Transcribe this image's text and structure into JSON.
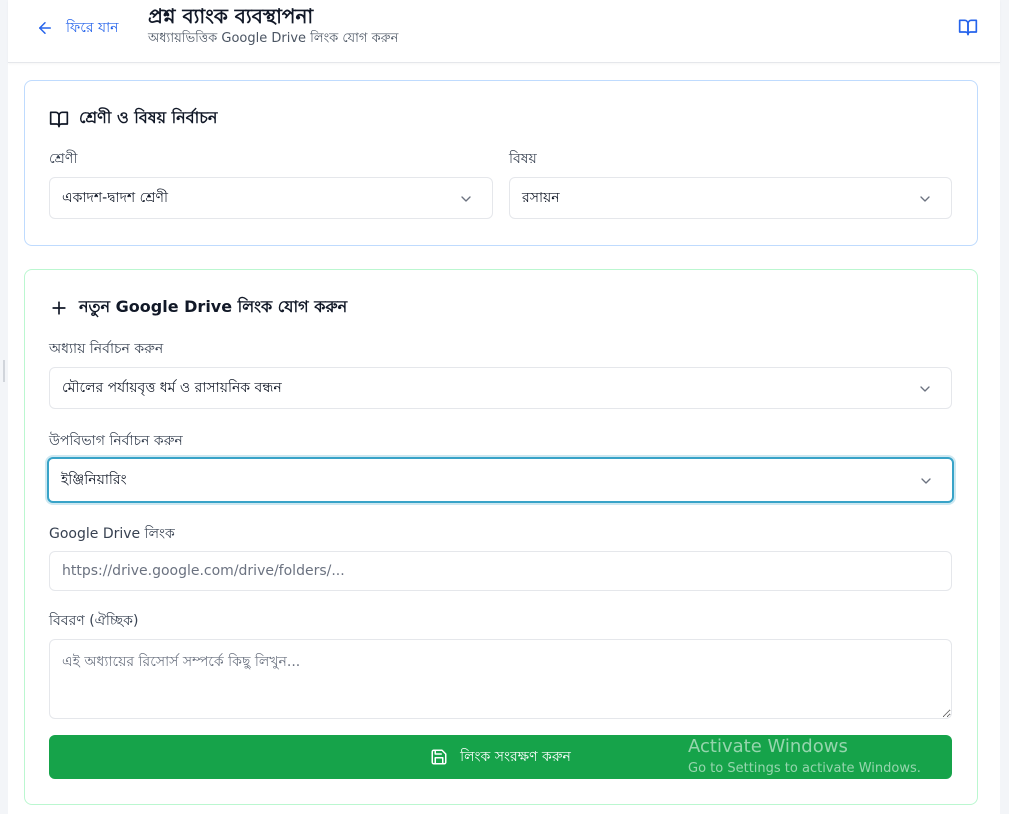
{
  "header": {
    "back_label": "ফিরে যান",
    "title": "প্রশ্ন ব্যাংক ব্যবস্থাপনা",
    "subtitle": "অধ্যায়ভিত্তিক Google Drive লিংক যোগ করুন"
  },
  "selection_card": {
    "title": "শ্রেণী ও বিষয় নির্বাচন",
    "class_label": "শ্রেণী",
    "class_value": "একাদশ-দ্বাদশ শ্রেণী",
    "subject_label": "বিষয়",
    "subject_value": "রসায়ন"
  },
  "link_card": {
    "title": "নতুন Google Drive লিংক যোগ করুন",
    "chapter_label": "অধ্যায় নির্বাচন করুন",
    "chapter_value": "মৌলের পর্যায়বৃত্ত ধর্ম ও রাসায়নিক বন্ধন",
    "subsection_label": "উপবিভাগ নির্বাচন করুন",
    "subsection_value": "ইঞ্জিনিয়ারিং",
    "drive_label": "Google Drive লিংক",
    "drive_placeholder": "https://drive.google.com/drive/folders/...",
    "drive_value": "",
    "description_label": "বিবরণ (ঐচ্ছিক)",
    "description_placeholder": "এই অধ্যায়ের রিসোর্স সম্পর্কে কিছু লিখুন...",
    "description_value": "",
    "save_label": "লিংক সংরক্ষণ করুন"
  },
  "watermark": {
    "line1": "Activate Windows",
    "line2": "Go to Settings to activate Windows."
  },
  "colors": {
    "primary_blue": "#2563eb",
    "save_green": "#16a34a",
    "card1_border": "#bfdbfe",
    "card2_border": "#bbf7d0",
    "focus_ring": "#38a3c8"
  },
  "icons": [
    "arrow-left-icon",
    "book-open-icon",
    "plus-icon",
    "chevron-down-icon",
    "save-icon"
  ]
}
